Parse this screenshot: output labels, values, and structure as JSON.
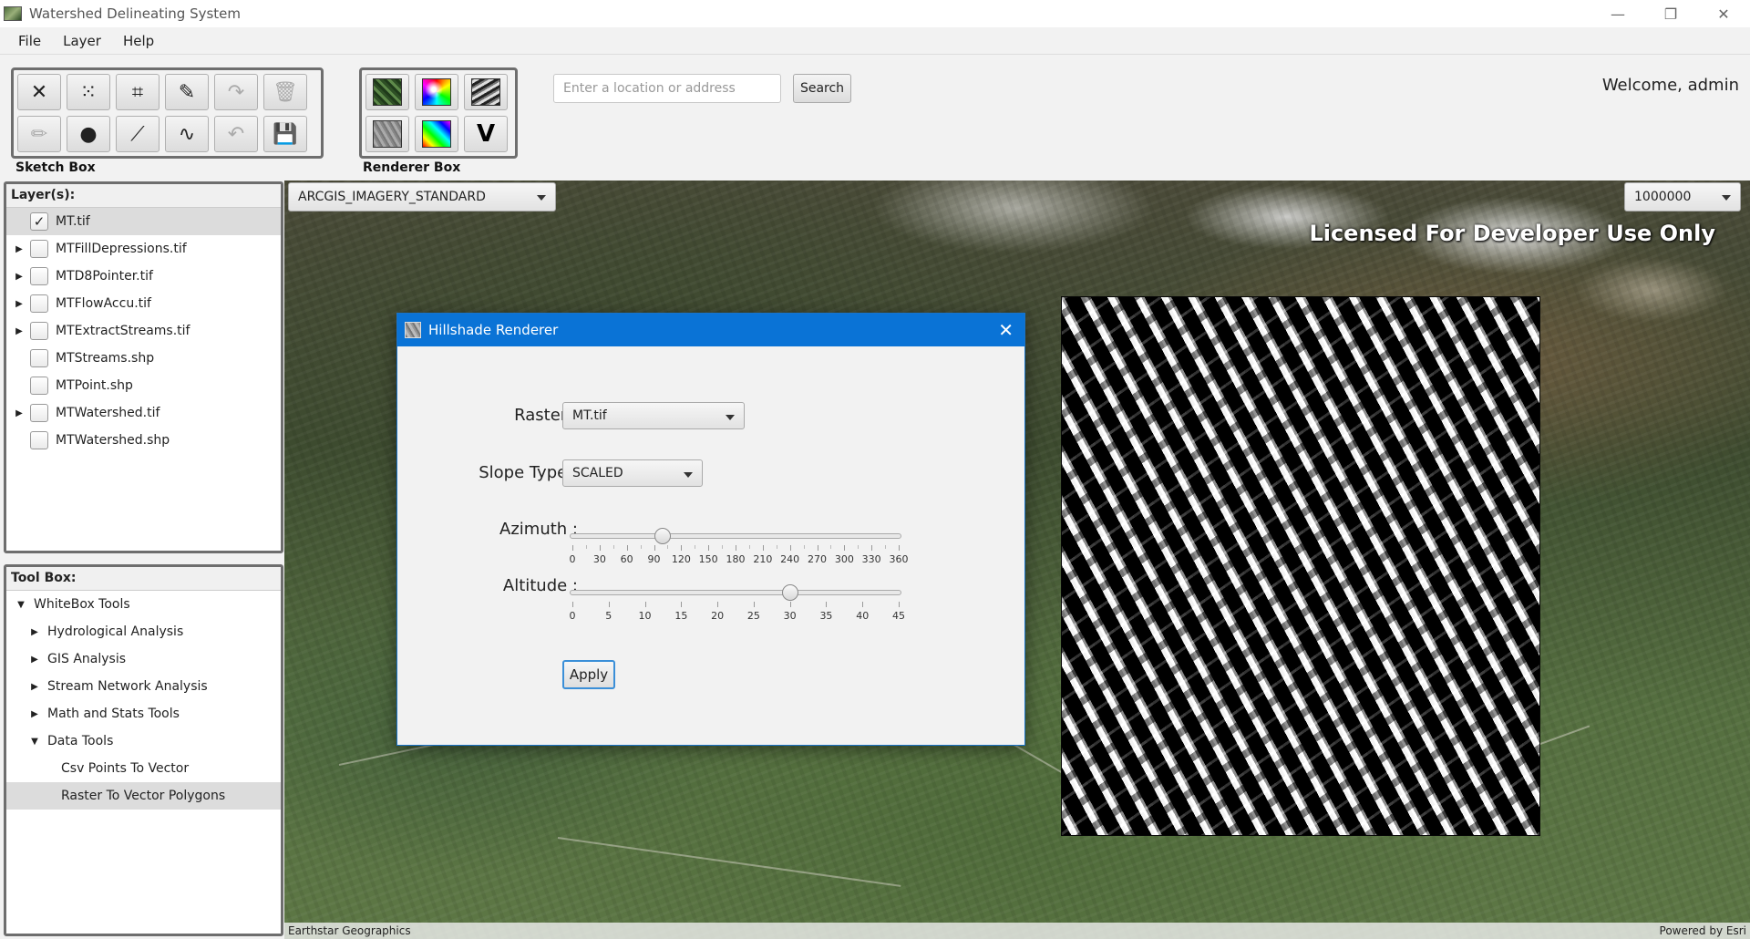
{
  "window": {
    "title": "Watershed Delineating System",
    "controls": {
      "minimize": "—",
      "restore": "❐",
      "close": "✕"
    }
  },
  "menu": [
    "File",
    "Layer",
    "Help"
  ],
  "sketch_box": {
    "label": "Sketch Box",
    "tools": [
      {
        "icon": "clear-icon",
        "glyph": "✕",
        "disabled": false
      },
      {
        "icon": "multipoint-icon",
        "glyph": "⁙",
        "disabled": false
      },
      {
        "icon": "polygon-icon",
        "glyph": "⌗",
        "disabled": false
      },
      {
        "icon": "freehand-icon",
        "glyph": "✎",
        "disabled": false
      },
      {
        "icon": "redo-icon",
        "glyph": "↷",
        "disabled": true
      },
      {
        "icon": "delete-icon",
        "glyph": "🗑",
        "disabled": true
      },
      {
        "icon": "edit-icon",
        "glyph": "✏",
        "disabled": true
      },
      {
        "icon": "point-icon",
        "glyph": "●",
        "disabled": false
      },
      {
        "icon": "polyline-icon",
        "glyph": "⟋",
        "disabled": false
      },
      {
        "icon": "freehand-line-icon",
        "glyph": "∿",
        "disabled": false
      },
      {
        "icon": "undo-icon",
        "glyph": "↶",
        "disabled": true
      },
      {
        "icon": "save-icon",
        "glyph": "💾",
        "disabled": true
      }
    ]
  },
  "renderer_box": {
    "label": "Renderer Box",
    "tools": [
      {
        "icon": "rgb-renderer-icon",
        "kind": "thumb-forest"
      },
      {
        "icon": "colormap-renderer-icon",
        "kind": "thumb-rainbow"
      },
      {
        "icon": "stretch-renderer-icon",
        "kind": "thumb-stripes"
      },
      {
        "icon": "hillshade-renderer-icon",
        "kind": "thumb-gray"
      },
      {
        "icon": "blend-renderer-icon",
        "kind": "thumb-spectrum"
      },
      {
        "icon": "vector-renderer-icon",
        "kind": "v",
        "text": "V"
      }
    ]
  },
  "search": {
    "placeholder": "Enter a location or address",
    "button": "Search"
  },
  "welcome": "Welcome, admin",
  "layers": {
    "header": "Layer(s):",
    "items": [
      {
        "name": "MT.tif",
        "checked": true,
        "expandable": false,
        "selected": true
      },
      {
        "name": "MTFillDepressions.tif",
        "checked": false,
        "expandable": true,
        "selected": false
      },
      {
        "name": "MTD8Pointer.tif",
        "checked": false,
        "expandable": true,
        "selected": false
      },
      {
        "name": "MTFlowAccu.tif",
        "checked": false,
        "expandable": true,
        "selected": false
      },
      {
        "name": "MTExtractStreams.tif",
        "checked": false,
        "expandable": true,
        "selected": false
      },
      {
        "name": "MTStreams.shp",
        "checked": false,
        "expandable": false,
        "selected": false
      },
      {
        "name": "MTPoint.shp",
        "checked": false,
        "expandable": false,
        "selected": false
      },
      {
        "name": "MTWatershed.tif",
        "checked": false,
        "expandable": true,
        "selected": false
      },
      {
        "name": "MTWatershed.shp",
        "checked": false,
        "expandable": false,
        "selected": false
      }
    ]
  },
  "toolbox": {
    "header": "Tool Box:",
    "items": [
      {
        "label": "WhiteBox Tools",
        "level": 0,
        "arrow": "▼",
        "selected": false
      },
      {
        "label": "Hydrological Analysis",
        "level": 1,
        "arrow": "▶",
        "selected": false
      },
      {
        "label": "GIS Analysis",
        "level": 1,
        "arrow": "▶",
        "selected": false
      },
      {
        "label": "Stream Network Analysis",
        "level": 1,
        "arrow": "▶",
        "selected": false
      },
      {
        "label": "Math and Stats Tools",
        "level": 1,
        "arrow": "▶",
        "selected": false
      },
      {
        "label": "Data Tools",
        "level": 1,
        "arrow": "▼",
        "selected": false
      },
      {
        "label": "Csv Points To Vector",
        "level": 2,
        "arrow": "",
        "selected": false
      },
      {
        "label": "Raster To Vector Polygons",
        "level": 2,
        "arrow": "",
        "selected": true
      }
    ]
  },
  "map": {
    "basemap": "ARCGIS_IMAGERY_STANDARD",
    "scale": "1000000",
    "license": "Licensed For Developer Use Only",
    "attribution_left": "Earthstar Geographics",
    "attribution_right": "Powered by Esri"
  },
  "dialog": {
    "title": "Hillshade Renderer",
    "close": "✕",
    "raster_label": "Raster :",
    "raster_value": "MT.tif",
    "slope_label": "Slope Type :",
    "slope_value": "SCALED",
    "azimuth_label": "Azimuth :",
    "azimuth": {
      "min": 0,
      "max": 360,
      "value": 100,
      "ticks": [
        "0",
        "30",
        "60",
        "90",
        "120",
        "150",
        "180",
        "210",
        "240",
        "270",
        "300",
        "330",
        "360"
      ]
    },
    "altitude_label": "Altitude :",
    "altitude": {
      "min": 0,
      "max": 45,
      "value": 30,
      "ticks": [
        "0",
        "5",
        "10",
        "15",
        "20",
        "25",
        "30",
        "35",
        "40",
        "45"
      ]
    },
    "apply": "Apply"
  }
}
